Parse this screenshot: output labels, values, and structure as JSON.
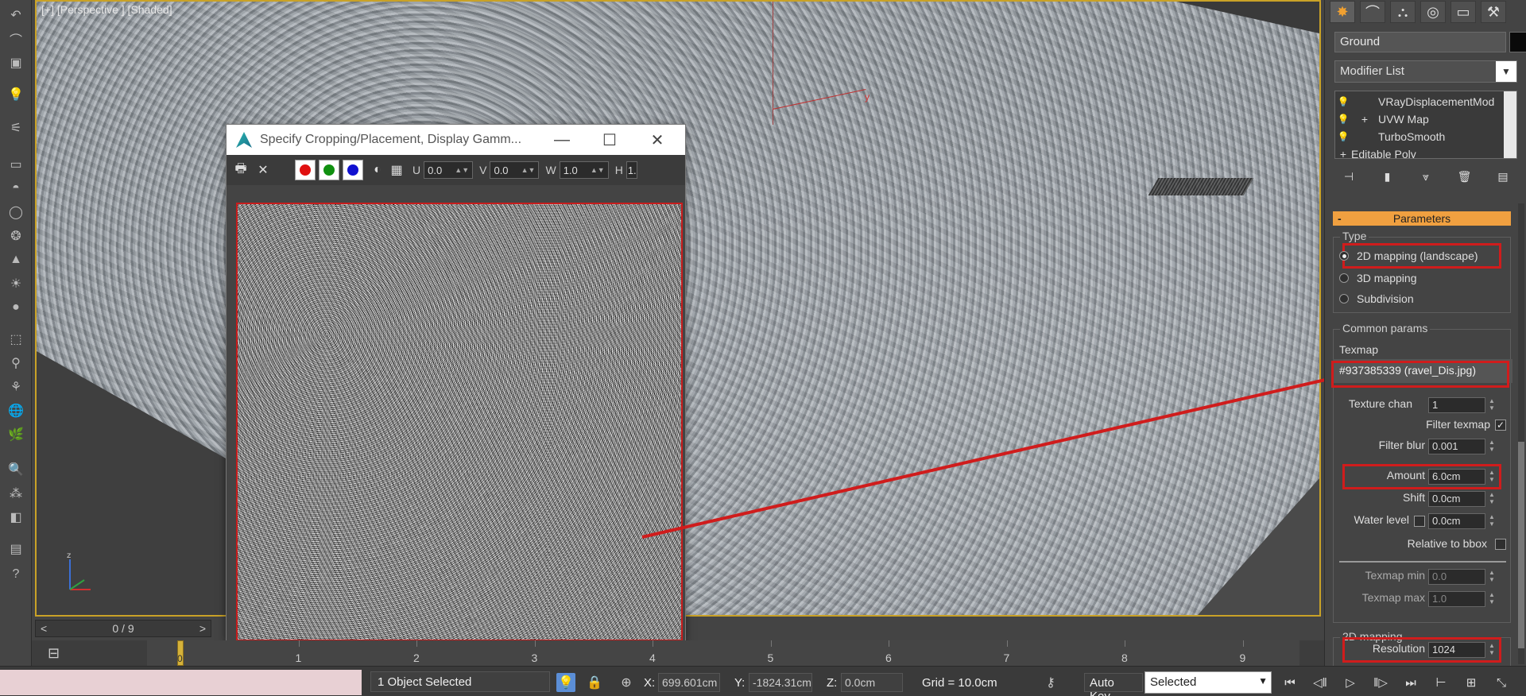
{
  "viewport": {
    "label": "[+] [Perspective ] [Shaded]",
    "axis_label": "y"
  },
  "dialog": {
    "title": "Specify Cropping/Placement, Display Gamm...",
    "minimize": "—",
    "maximize": "☐",
    "close": "✕",
    "toolbar": {
      "u_label": "U",
      "u_value": "0.0",
      "v_label": "V",
      "v_value": "0.0",
      "w_label": "W",
      "w_value": "1.0",
      "h_label": "H",
      "h_value": "1.",
      "colors": [
        "#e01010",
        "#109010",
        "#1010d0"
      ]
    }
  },
  "command_panel": {
    "object_name": "Ground",
    "modifier_list": "Modifier List",
    "stack": [
      {
        "label": "VRayDisplacementMod",
        "expander": ""
      },
      {
        "label": "UVW Map",
        "expander": "+"
      },
      {
        "label": "TurboSmooth",
        "expander": ""
      },
      {
        "label": "Editable Poly",
        "expander": "+"
      }
    ],
    "rollout_title": "Parameters",
    "type_group": "Type",
    "type_options": [
      {
        "label": "2D mapping (landscape)",
        "selected": true
      },
      {
        "label": "3D mapping",
        "selected": false
      },
      {
        "label": "Subdivision",
        "selected": false
      }
    ],
    "common_group": "Common params",
    "texmap_label": "Texmap",
    "texmap_value": "#937385339 (ravel_Dis.jpg)",
    "texture_chan_label": "Texture chan",
    "texture_chan": "1",
    "filter_texmap_label": "Filter texmap",
    "filter_texmap_checked": "✓",
    "filter_blur_label": "Filter blur",
    "filter_blur": "0.001",
    "amount_label": "Amount",
    "amount": "6.0cm",
    "shift_label": "Shift",
    "shift": "0.0cm",
    "water_level_label": "Water level",
    "water_level": "0.0cm",
    "relative_bbox_label": "Relative to bbox",
    "texmap_min_label": "Texmap min",
    "texmap_min": "0.0",
    "texmap_max_label": "Texmap max",
    "texmap_max": "1.0",
    "mapping2d_group": "2D mapping",
    "resolution_label": "Resolution",
    "resolution": "1024"
  },
  "timeline": {
    "slider_text": "0 / 9",
    "prev": "<",
    "next": ">",
    "ticks": [
      "1",
      "2",
      "3",
      "4",
      "5",
      "6",
      "7",
      "8",
      "9"
    ],
    "playhead_label": "0"
  },
  "status_bar": {
    "selection": "1 Object Selected",
    "x_label": "X:",
    "x_value": "699.601cm",
    "y_label": "Y:",
    "y_value": "-1824.31cm",
    "z_label": "Z:",
    "z_value": "0.0cm",
    "grid": "Grid = 10.0cm",
    "auto_key": "Auto Key",
    "selected_dropdown": "Selected"
  },
  "colors": {
    "highlight_red": "#d01c1c",
    "rollout_orange": "#f0a040",
    "viewport_border": "#c9a227"
  }
}
